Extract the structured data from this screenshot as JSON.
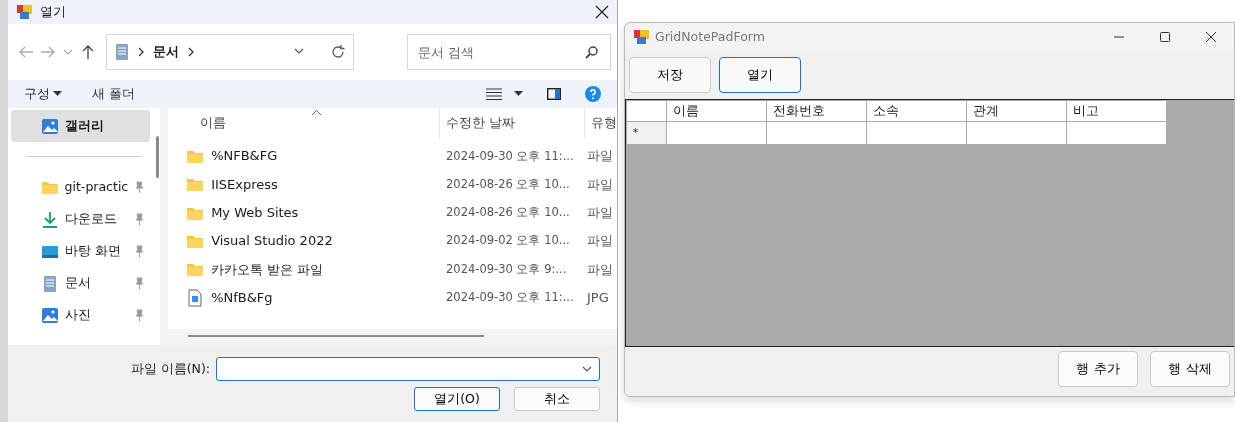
{
  "open_dialog": {
    "title": "열기",
    "address": {
      "crumbs": [
        "문서"
      ]
    },
    "search": {
      "placeholder": "문서 검색"
    },
    "toolbar": {
      "organize": "구성",
      "new_folder": "새 폴더"
    },
    "sidebar": {
      "items": [
        {
          "label": "갤러리",
          "kind": "gallery",
          "selected": true,
          "pinned": false
        },
        {
          "label": "git-practic",
          "kind": "folder",
          "selected": false,
          "pinned": true
        },
        {
          "label": "다운로드",
          "kind": "download",
          "selected": false,
          "pinned": true
        },
        {
          "label": "바탕 화면",
          "kind": "desktop",
          "selected": false,
          "pinned": true
        },
        {
          "label": "문서",
          "kind": "documents",
          "selected": false,
          "pinned": true
        },
        {
          "label": "사진",
          "kind": "pictures",
          "selected": false,
          "pinned": true
        }
      ]
    },
    "columns": [
      "이름",
      "수정한 날짜",
      "유형"
    ],
    "files": [
      {
        "name": "%NFB&FG",
        "date": "2024-09-30 오후 11:...",
        "type": "파일",
        "kind": "folder"
      },
      {
        "name": "IISExpress",
        "date": "2024-08-26 오후 10...",
        "type": "파일",
        "kind": "folder"
      },
      {
        "name": "My Web Sites",
        "date": "2024-08-26 오후 10...",
        "type": "파일",
        "kind": "folder"
      },
      {
        "name": "Visual Studio 2022",
        "date": "2024-09-02 오후 10...",
        "type": "파일",
        "kind": "folder"
      },
      {
        "name": "카카오톡 받은 파일",
        "date": "2024-09-30 오후 9:...",
        "type": "파일",
        "kind": "folder"
      },
      {
        "name": "%NfB&Fg",
        "date": "2024-09-30 오후 11:...",
        "type": "JPG",
        "kind": "image"
      }
    ],
    "file_name_label": "파일 이름(N):",
    "buttons": [
      {
        "label": "열기(O)",
        "default": true
      },
      {
        "label": "취소",
        "default": false
      }
    ]
  },
  "form": {
    "title": "GridNotePadForm",
    "top_buttons": [
      {
        "label": "저장",
        "focused": false
      },
      {
        "label": "열기",
        "focused": true
      }
    ],
    "grid": {
      "columns": [
        "이름",
        "전화번호",
        "소속",
        "관계",
        "비고"
      ],
      "new_row_marker": "*"
    },
    "bottom_buttons": [
      {
        "label": "행 추가"
      },
      {
        "label": "행 삭제"
      }
    ]
  }
}
